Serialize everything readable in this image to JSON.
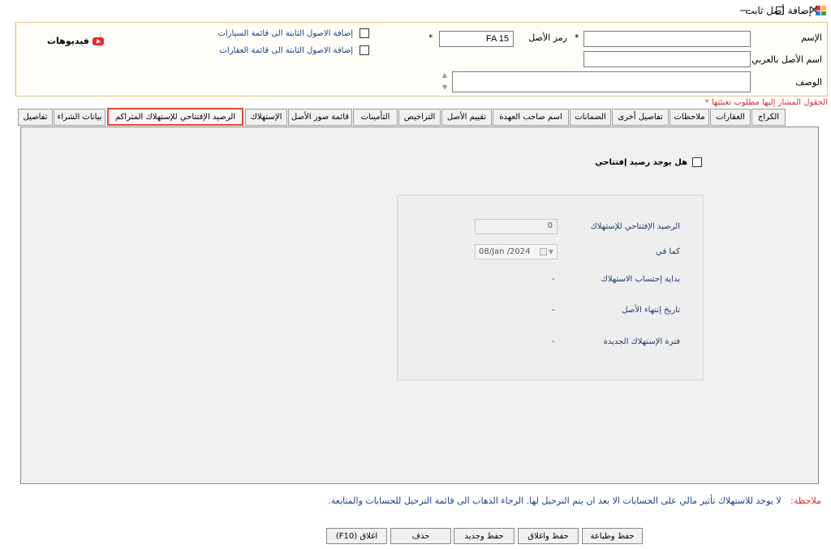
{
  "window": {
    "title": "إضافة أصل ثابت",
    "minimize": "—",
    "close": "✕"
  },
  "header": {
    "name_label": "الإسم",
    "name_value": "",
    "arabic_name_label": "اسم الأصل بالعربي",
    "arabic_name_value": "",
    "description_label": "الوصف",
    "description_value": "",
    "asset_code_label": "رمز الأصل",
    "asset_code_value": "FA 15",
    "required_mark": "*",
    "add_to_cars_label": "إضافة الاصول الثابتة الى قائمة السيارات",
    "add_to_realestate_label": "إضافة الاصول الثابتة الى قائمة العقارات",
    "videos_label": "فيديوهات"
  },
  "required_note": "الحقول المشار إليها مطلوب تعبئتها *",
  "tabs": [
    {
      "label": "الكراج"
    },
    {
      "label": "العقارات"
    },
    {
      "label": "ملاحظات"
    },
    {
      "label": "تفاصيل أخرى"
    },
    {
      "label": "الضمانات"
    },
    {
      "label": "اسم صاحب العهدة"
    },
    {
      "label": "تقييم الأصل"
    },
    {
      "label": "التراخيص"
    },
    {
      "label": "التأمينات"
    },
    {
      "label": "قائمة صور الأصل"
    },
    {
      "label": "الإستهلاك"
    },
    {
      "label": "الرصيد الإفتتاحي للإستهلاك المتراكم"
    },
    {
      "label": "بيانات الشراء"
    },
    {
      "label": "تفاصيل"
    }
  ],
  "active_tab_index": 11,
  "opening_balance": {
    "has_opening_label": "هل يوجد رصيد إفتتاحي",
    "opening_balance_label": "الرصيد الإفتتاحي للإستهلاك",
    "opening_balance_value": "0",
    "as_of_label": "كما في",
    "as_of_value": "08/Jan /2024",
    "start_label": "بداية إحتساب الاستهلاك",
    "start_value": "-",
    "end_label": "تاريخ إنتهاء الأصل",
    "end_value": "-",
    "period_label": "فترة الإستهلاك الجديدة",
    "period_value": "-"
  },
  "footer": {
    "note_label": "ملاحظة:",
    "note_text": "لا يوجد للاستهلاك تأثير مالي على الحسابات الا بعد ان يتم الترحيل لها. الرجاء الذهاب الى قائمة الترحيل للحسابات والمتابعة."
  },
  "buttons": {
    "save_print": "حفظ وطباعة",
    "save_close": "حفظ واغلاق",
    "save_new": "حفظ وجديد",
    "delete": "حذف",
    "close": "اغلاق (F10)"
  }
}
